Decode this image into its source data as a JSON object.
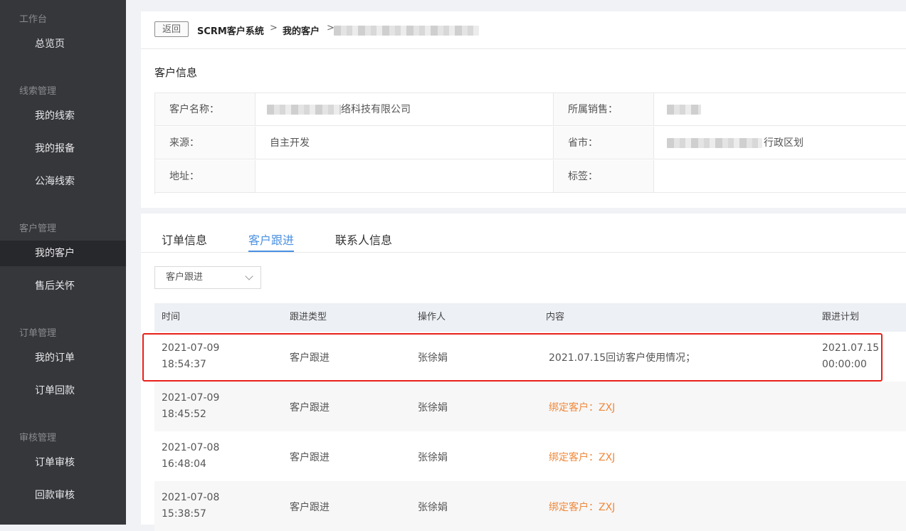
{
  "sidebar": {
    "groups": [
      {
        "label": "工作台",
        "items": [
          {
            "label": "总览页"
          }
        ]
      },
      {
        "label": "线索管理",
        "items": [
          {
            "label": "我的线索"
          },
          {
            "label": "我的报备"
          },
          {
            "label": "公海线索"
          }
        ]
      },
      {
        "label": "客户管理",
        "items": [
          {
            "label": "我的客户"
          },
          {
            "label": "售后关怀"
          }
        ]
      },
      {
        "label": "订单管理",
        "items": [
          {
            "label": "我的订单"
          },
          {
            "label": "订单回款"
          }
        ]
      },
      {
        "label": "审核管理",
        "items": [
          {
            "label": "订单审核"
          },
          {
            "label": "回款审核"
          }
        ]
      }
    ],
    "active_item": "我的客户"
  },
  "topbar": {
    "back_label": "返回",
    "breadcrumb": [
      "SCRM客户系统",
      "我的客户"
    ],
    "separator": ">"
  },
  "customer_info": {
    "title": "客户信息",
    "fields": {
      "name": {
        "label": "客户名称：",
        "value_suffix": "络科技有限公司"
      },
      "sales": {
        "label": "所属销售："
      },
      "source": {
        "label": "来源：",
        "value": "自主开发"
      },
      "province": {
        "label": "省市：",
        "value_suffix": "行政区划"
      },
      "address": {
        "label": "地址：",
        "value": ""
      },
      "tags": {
        "label": "标签：",
        "value": ""
      }
    }
  },
  "tabs": [
    {
      "label": "订单信息"
    },
    {
      "label": "客户跟进"
    },
    {
      "label": "联系人信息"
    }
  ],
  "active_tab": "客户跟进",
  "filter": {
    "selected": "客户跟进"
  },
  "table": {
    "columns": [
      "时间",
      "跟进类型",
      "操作人",
      "内容",
      "跟进计划"
    ],
    "rows": [
      {
        "date": "2021-07-09",
        "time": "18:54:37",
        "type": "客户跟进",
        "operator": "张徐娟",
        "content": "2021.07.15回访客户使用情况；",
        "plan_date": "2021.07.15",
        "plan_time": "00:00:00"
      },
      {
        "date": "2021-07-09",
        "time": "18:45:52",
        "type": "客户跟进",
        "operator": "张徐娟",
        "content": "绑定客户：ZXJ",
        "plan_date": "",
        "plan_time": ""
      },
      {
        "date": "2021-07-08",
        "time": "16:48:04",
        "type": "客户跟进",
        "operator": "张徐娟",
        "content": "绑定客户：ZXJ",
        "plan_date": "",
        "plan_time": ""
      },
      {
        "date": "2021-07-08",
        "time": "15:38:57",
        "type": "客户跟进",
        "operator": "张徐娟",
        "content": "绑定客户：ZXJ",
        "plan_date": "",
        "plan_time": ""
      }
    ]
  },
  "colors": {
    "sidebar_bg": "#36373b",
    "sidebar_active_bg": "#27282b",
    "accent": "#4a90e2",
    "highlight_border": "#e8201a",
    "orange_text": "#f0883a"
  },
  "icons": {
    "select_arrow": "chevron-down-icon",
    "crumb_separator": "chevron-right-icon"
  }
}
